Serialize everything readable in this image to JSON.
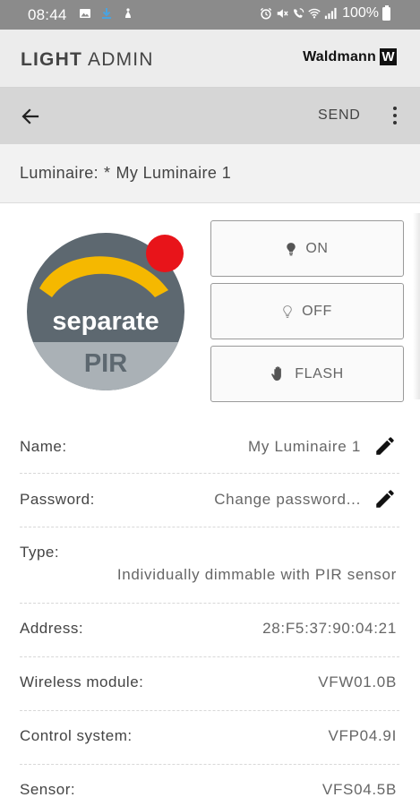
{
  "status_bar": {
    "time": "08:44",
    "battery": "100%"
  },
  "header": {
    "brand_bold": "LIGHT",
    "brand_rest": "ADMIN",
    "logo_text": "Waldmann",
    "logo_mark": "W"
  },
  "toolbar": {
    "back_icon": "arrow-left-icon",
    "send_label": "SEND",
    "menu_icon": "more-vert-icon"
  },
  "luminaire": {
    "label": "Luminaire:",
    "modified_marker": "*",
    "name": "My Luminaire 1"
  },
  "badge": {
    "line1": "separate",
    "line2": "PIR",
    "colors": {
      "body": "#5d6870",
      "arc": "#f5b800",
      "bottom": "#aab1b6",
      "dot": "#e8141a"
    }
  },
  "controls": [
    {
      "label": "ON",
      "icon": "bulb-filled-icon"
    },
    {
      "label": "OFF",
      "icon": "bulb-outline-icon"
    },
    {
      "label": "FLASH",
      "icon": "hand-icon"
    }
  ],
  "properties": {
    "name": {
      "label": "Name:",
      "value": "My Luminaire 1"
    },
    "password": {
      "label": "Password:",
      "value": "Change password..."
    },
    "type": {
      "label": "Type:",
      "value": "Individually dimmable with PIR sensor"
    },
    "address": {
      "label": "Address:",
      "value": "28:F5:37:90:04:21"
    },
    "wireless": {
      "label": "Wireless module:",
      "value": "VFW01.0B"
    },
    "control": {
      "label": "Control system:",
      "value": "VFP04.9I"
    },
    "sensor": {
      "label": "Sensor:",
      "value": "VFS04.5B"
    }
  }
}
